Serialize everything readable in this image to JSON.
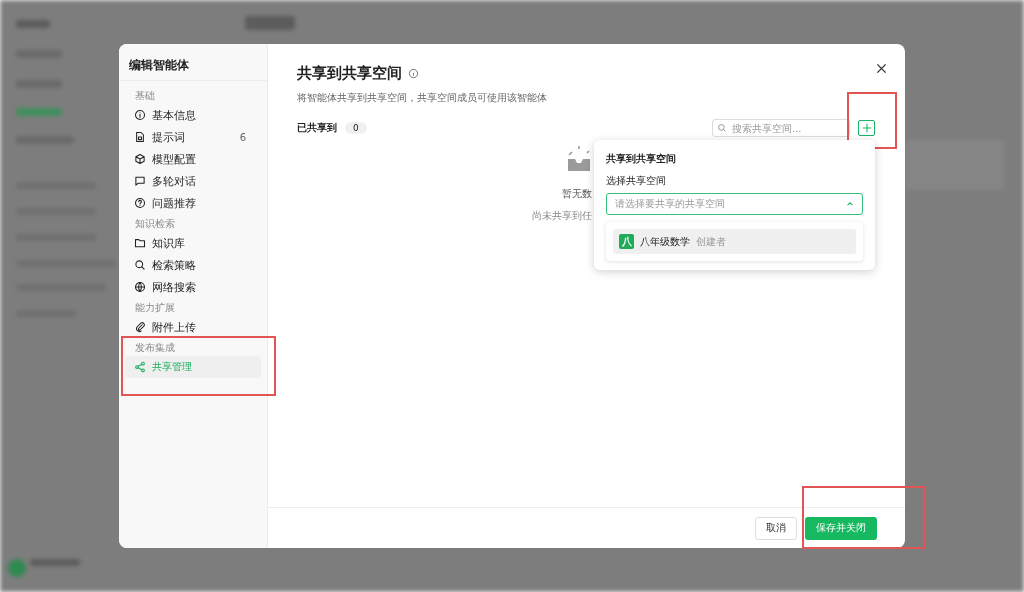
{
  "dialog": {
    "title": "编辑智能体",
    "nav": [
      {
        "section": "基础",
        "items": [
          {
            "label": "基本信息",
            "selected": false
          },
          {
            "label": "提示词",
            "badge": "6",
            "selected": false
          },
          {
            "label": "模型配置",
            "selected": false
          },
          {
            "label": "多轮对话",
            "selected": false
          },
          {
            "label": "问题推荐",
            "selected": false
          }
        ]
      },
      {
        "section": "知识检索",
        "items": [
          {
            "label": "知识库",
            "selected": false
          },
          {
            "label": "检索策略",
            "selected": false
          },
          {
            "label": "网络搜索",
            "selected": false
          }
        ]
      },
      {
        "section": "能力扩展",
        "items": [
          {
            "label": "附件上传",
            "selected": false
          }
        ]
      },
      {
        "section": "发布集成",
        "highlighted": true,
        "items": [
          {
            "label": "共享管理",
            "selected": true
          }
        ]
      }
    ],
    "heading": "共享到共享空间",
    "description": "将智能体共享到共享空间，共享空间成员可使用该智能体",
    "shared_label": "已共享到",
    "shared_count": "0",
    "search": {
      "placeholder": "搜索共享空间..."
    },
    "add_button": {
      "highlighted": true
    },
    "empty": {
      "title": "暂无数",
      "text": "尚未共享到任"
    },
    "popover": {
      "title": "共享到共享空间",
      "field_label": "选择共享空间",
      "select": {
        "placeholder": "请选择要共享的共享空间",
        "expanded": true
      },
      "options": [
        {
          "avatar": "八",
          "name": "八年级数学",
          "role": "创建者",
          "selected": false
        }
      ]
    },
    "buttons": [
      {
        "kind": "secondary",
        "label": "取消"
      },
      {
        "kind": "primary",
        "label": "保存并关闭",
        "highlighted": true
      }
    ]
  }
}
